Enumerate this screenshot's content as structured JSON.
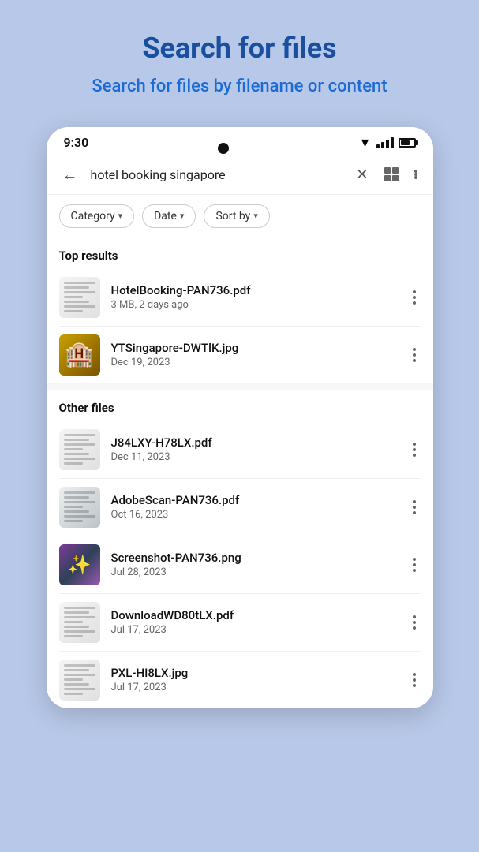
{
  "header": {
    "title": "Search for files",
    "subtitle": "Search for files by filename or content"
  },
  "statusBar": {
    "time": "9:30",
    "wifi": "▼",
    "batteryLevel": 70
  },
  "searchBar": {
    "query": "hotel booking singapore",
    "backLabel": "←",
    "clearLabel": "×",
    "moreLabel": "⋮"
  },
  "filters": [
    {
      "label": "Category",
      "id": "category"
    },
    {
      "label": "Date",
      "id": "date"
    },
    {
      "label": "Sort by",
      "id": "sort"
    }
  ],
  "sections": [
    {
      "title": "Top results",
      "id": "top-results",
      "items": [
        {
          "name": "HotelBooking-PAN736.pdf",
          "meta": "3 MB, 2 days ago",
          "thumbType": "pdf-lines"
        },
        {
          "name": "YTSingapore-DWTlK.jpg",
          "meta": "Dec 19, 2023",
          "thumbType": "hotel-building"
        }
      ]
    },
    {
      "title": "Other files",
      "id": "other-files",
      "items": [
        {
          "name": "J84LXY-H78LX.pdf",
          "meta": "Dec 11, 2023",
          "thumbType": "pdf-lines"
        },
        {
          "name": "AdobeScan-PAN736.pdf",
          "meta": "Oct 16, 2023",
          "thumbType": "pdf-scan"
        },
        {
          "name": "Screenshot-PAN736.png",
          "meta": "Jul 28, 2023",
          "thumbType": "stars-purple"
        },
        {
          "name": "DownloadWD80tLX.pdf",
          "meta": "Jul 17, 2023",
          "thumbType": "pdf-lines"
        },
        {
          "name": "PXL-HI8LX.jpg",
          "meta": "Jul 17, 2023",
          "thumbType": "pdf-lines"
        }
      ]
    }
  ]
}
